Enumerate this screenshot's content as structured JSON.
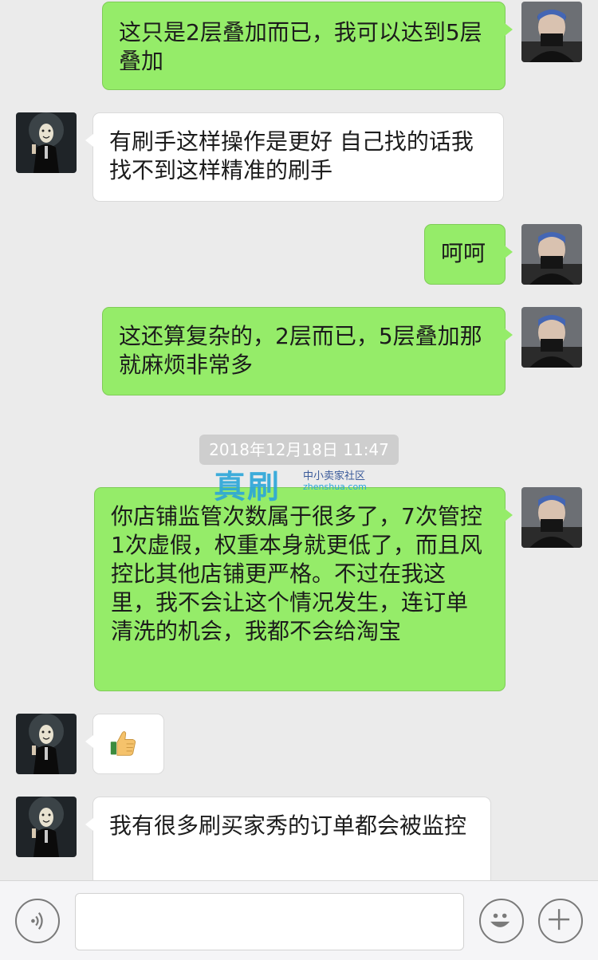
{
  "messages": [
    {
      "side": "right",
      "text": "这只是2层叠加而已，我可以达到5层叠加"
    },
    {
      "side": "left",
      "text": "有刷手这样操作是更好 自己找的话我找不到这样精准的刷手"
    },
    {
      "side": "right",
      "text": "呵呵"
    },
    {
      "side": "right",
      "text": "这还算复杂的，2层而已，5层叠加那就麻烦非常多"
    },
    {
      "side": "right",
      "text": "你店铺监管次数属于很多了，7次管控 1次虚假，权重本身就更低了，而且风控比其他店铺更严格。不过在我这里，我不会让这个情况发生，连订单清洗的机会，我都不会给淘宝"
    },
    {
      "side": "left",
      "text": "👍",
      "type": "emoji"
    },
    {
      "side": "left",
      "text": "我有很多刷买家秀的订单都会被监控"
    }
  ],
  "timestamp": "2018年12月18日 11:47",
  "watermark": {
    "logo": "真刷",
    "tagline": "中小卖家社区",
    "url": "zhenshua.com"
  },
  "toolbar": {
    "input_value": "",
    "voice_icon": "voice-icon",
    "emoji_icon": "emoji-icon",
    "plus_icon": "plus-icon"
  },
  "colors": {
    "background": "#ebebeb",
    "sent_bubble": "#95ec69",
    "received_bubble": "#ffffff",
    "timestamp_bg": "#cecece"
  }
}
